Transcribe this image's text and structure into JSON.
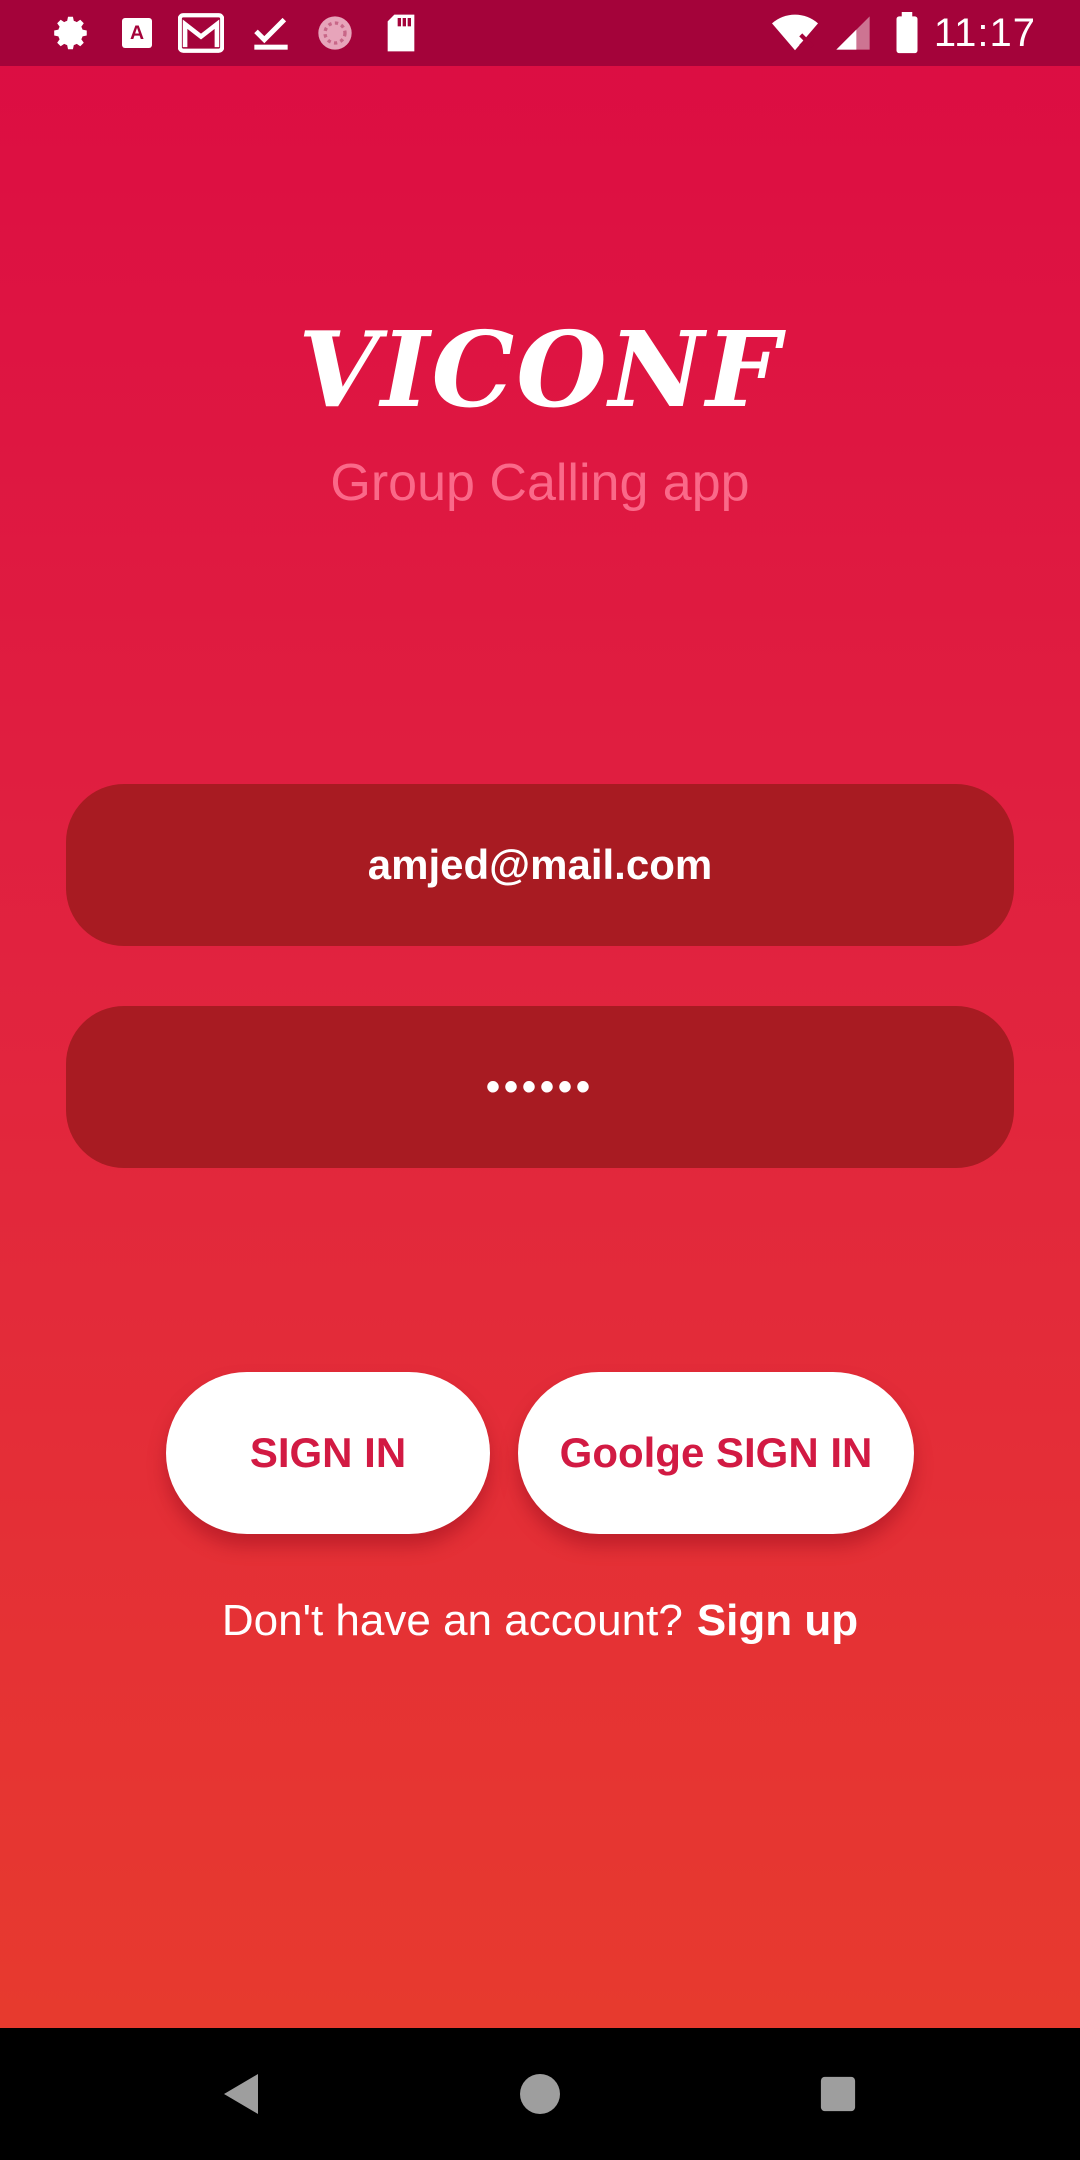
{
  "status_bar": {
    "time": "11:17",
    "left_icons": [
      "gear-icon",
      "text-a-icon",
      "gmail-icon",
      "check-icon",
      "sync-circle-icon",
      "sd-card-icon"
    ],
    "right_icons": [
      "wifi-off-icon",
      "signal-icon",
      "battery-icon"
    ]
  },
  "app": {
    "logo": "VICONF",
    "tagline": "Group Calling app"
  },
  "form": {
    "email_value": "amjed@mail.com",
    "password_value": "••••••"
  },
  "buttons": {
    "sign_in": "SIGN IN",
    "google_sign_in": "Goolge SIGN IN"
  },
  "signup": {
    "prompt": "Don't have an account?",
    "link": "Sign up"
  },
  "nav": {
    "icons": [
      "back-icon",
      "home-icon",
      "recents-icon"
    ]
  },
  "colors": {
    "gradient_top": "#dc0c43",
    "gradient_bottom": "#e83d2c",
    "status_bar": "#a4033a",
    "field_bg": "#a81b22",
    "button_text": "#d21a43"
  }
}
